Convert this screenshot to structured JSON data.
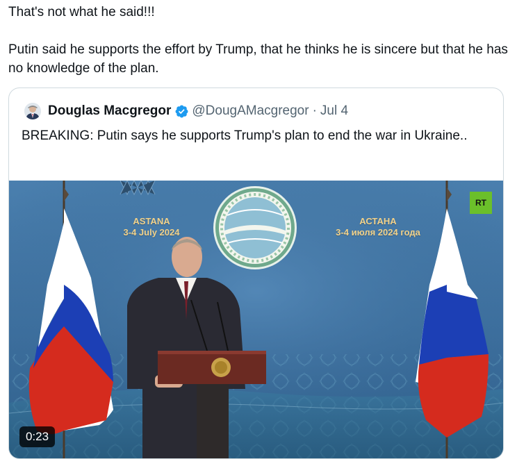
{
  "tweet": {
    "line1": "That's not what he said!!!",
    "line2": "Putin said he supports the effort by Trump, that he thinks he is sincere but that he has no knowledge of the plan."
  },
  "quoted": {
    "author_name": "Douglas Macgregor",
    "handle": "@DougAMacgregor",
    "separator": "·",
    "date": "Jul 4",
    "text": "BREAKING: Putin says he supports Trump's plan to end the war in Ukraine..",
    "verified_icon": "verified-badge-icon",
    "verified_color": "#1d9bf0"
  },
  "media": {
    "venue_en_city": "ASTANA",
    "venue_en_dates": "3-4 July 2024",
    "venue_ru_city": "АСТАНА",
    "venue_ru_dates": "3-4 июля 2024 года",
    "channel_logo": "RT",
    "duration": "0:23"
  },
  "colors": {
    "backdrop": "#3d6f9e",
    "flag_white": "#ffffff",
    "flag_blue": "#1c3fb5",
    "flag_red": "#d52b1e",
    "podium": "#6b2a22",
    "accent_text": "#f2d28a"
  }
}
